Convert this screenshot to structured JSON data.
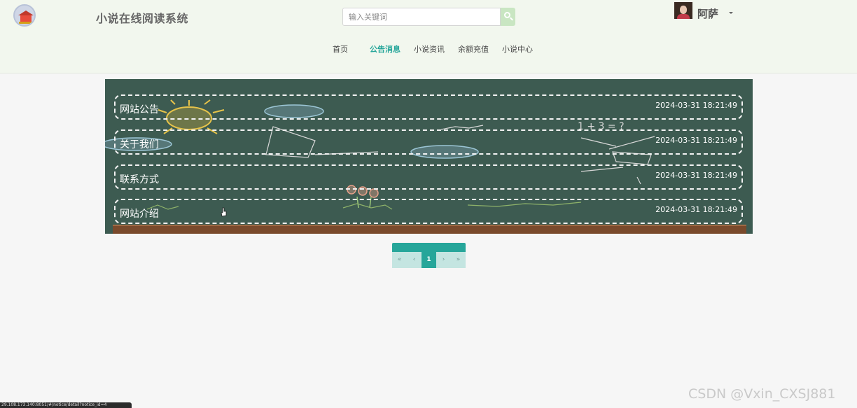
{
  "header": {
    "site_title": "小说在线阅读系统",
    "search": {
      "placeholder": "输入关键词",
      "icon": "search-icon"
    },
    "user": {
      "name": "阿萨"
    },
    "nav": [
      {
        "label": "首页",
        "active": false
      },
      {
        "label": "公告消息",
        "active": true
      },
      {
        "label": "小说资讯",
        "active": false
      },
      {
        "label": "余额充值",
        "active": false
      },
      {
        "label": "小说中心",
        "active": false
      }
    ]
  },
  "notices": [
    {
      "title": "网站公告",
      "time": "2024-03-31 18:21:49"
    },
    {
      "title": "关于我们",
      "time": "2024-03-31 18:21:49"
    },
    {
      "title": "联系方式",
      "time": "2024-03-31 18:21:49"
    },
    {
      "title": "网站介绍",
      "time": "2024-03-31 18:21:49"
    }
  ],
  "pagination": {
    "first": "«",
    "prev": "‹",
    "current": "1",
    "next": "›",
    "last": "»"
  },
  "status_bar": {
    "url": "29.108.173.140:8051/#/notice/detail?notice_id=4"
  },
  "watermark": "CSDN @Vxin_CXSJ881",
  "colors": {
    "accent": "#26a69a",
    "header_bg": "#f2f7ee",
    "board_bg": "#3d5b51",
    "page_bg": "#f6f6f6"
  }
}
